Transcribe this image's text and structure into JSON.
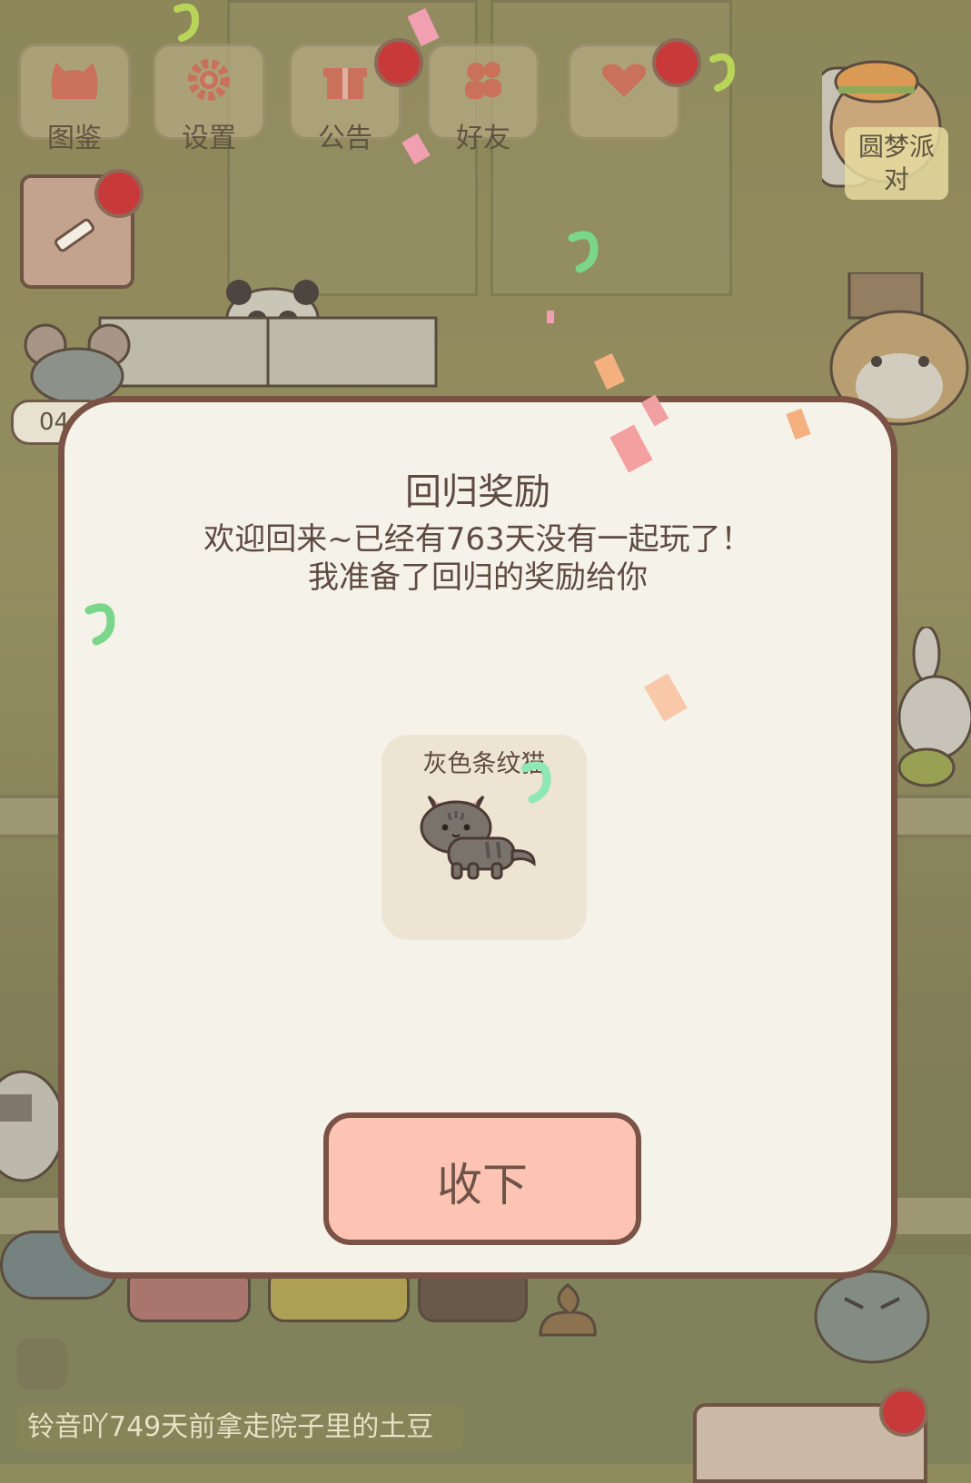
{
  "top_menu": {
    "items": [
      {
        "label": "图鉴",
        "icon": "cat-icon"
      },
      {
        "label": "设置",
        "icon": "gear-icon"
      },
      {
        "label": "公告",
        "icon": "gift-icon"
      },
      {
        "label": "好友",
        "icon": "friends-icon"
      },
      {
        "label": "",
        "icon": "heart-icon"
      }
    ]
  },
  "side_event": {
    "label": "圆梦派对"
  },
  "hud": {
    "counter_partial": "04"
  },
  "dialog": {
    "title": "回归奖励",
    "message_line1": "欢迎回来~已经有763天没有一起玩了！",
    "message_line2": "我准备了回归的奖励给你",
    "reward": {
      "name": "灰色条纹猫",
      "icon": "gray-tabby-cat-icon"
    },
    "accept_label": "收下"
  },
  "ticker": {
    "text": "铃音吖749天前拿走院子里的土豆"
  },
  "colors": {
    "dialog_bg": "#f5f2ea",
    "dialog_border": "#7a5346",
    "accept_bg": "#fdc4b3",
    "notify_red": "#c83a3a"
  }
}
